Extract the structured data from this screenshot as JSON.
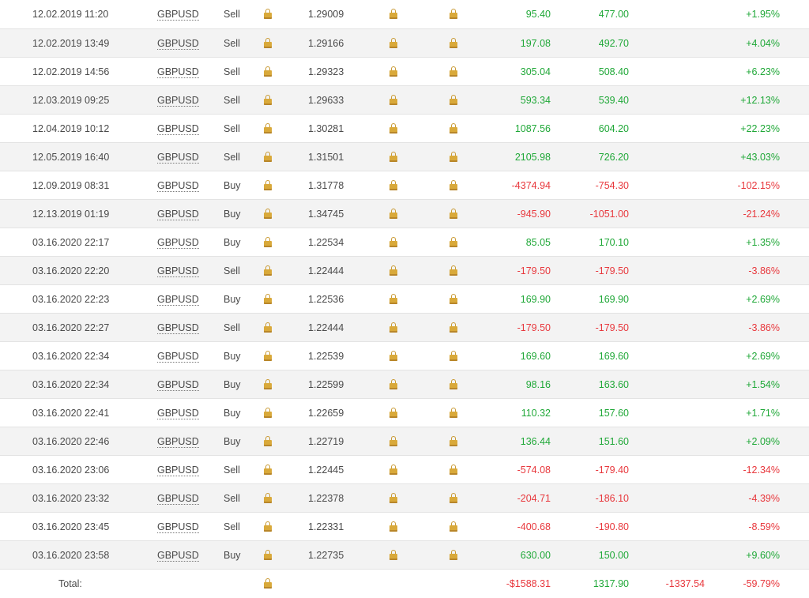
{
  "table": {
    "rows": [
      {
        "date": "12.02.2019 11:20",
        "symbol": "GBPUSD",
        "type": "Sell",
        "price": "1.29009",
        "profit": "95.40",
        "pips": "477.00",
        "gain": "+1.95%",
        "sign": "pos"
      },
      {
        "date": "12.02.2019 13:49",
        "symbol": "GBPUSD",
        "type": "Sell",
        "price": "1.29166",
        "profit": "197.08",
        "pips": "492.70",
        "gain": "+4.04%",
        "sign": "pos"
      },
      {
        "date": "12.02.2019 14:56",
        "symbol": "GBPUSD",
        "type": "Sell",
        "price": "1.29323",
        "profit": "305.04",
        "pips": "508.40",
        "gain": "+6.23%",
        "sign": "pos"
      },
      {
        "date": "12.03.2019 09:25",
        "symbol": "GBPUSD",
        "type": "Sell",
        "price": "1.29633",
        "profit": "593.34",
        "pips": "539.40",
        "gain": "+12.13%",
        "sign": "pos"
      },
      {
        "date": "12.04.2019 10:12",
        "symbol": "GBPUSD",
        "type": "Sell",
        "price": "1.30281",
        "profit": "1087.56",
        "pips": "604.20",
        "gain": "+22.23%",
        "sign": "pos"
      },
      {
        "date": "12.05.2019 16:40",
        "symbol": "GBPUSD",
        "type": "Sell",
        "price": "1.31501",
        "profit": "2105.98",
        "pips": "726.20",
        "gain": "+43.03%",
        "sign": "pos"
      },
      {
        "date": "12.09.2019 08:31",
        "symbol": "GBPUSD",
        "type": "Buy",
        "price": "1.31778",
        "profit": "-4374.94",
        "pips": "-754.30",
        "gain": "-102.15%",
        "sign": "neg"
      },
      {
        "date": "12.13.2019 01:19",
        "symbol": "GBPUSD",
        "type": "Buy",
        "price": "1.34745",
        "profit": "-945.90",
        "pips": "-1051.00",
        "gain": "-21.24%",
        "sign": "neg"
      },
      {
        "date": "03.16.2020 22:17",
        "symbol": "GBPUSD",
        "type": "Buy",
        "price": "1.22534",
        "profit": "85.05",
        "pips": "170.10",
        "gain": "+1.35%",
        "sign": "pos"
      },
      {
        "date": "03.16.2020 22:20",
        "symbol": "GBPUSD",
        "type": "Sell",
        "price": "1.22444",
        "profit": "-179.50",
        "pips": "-179.50",
        "gain": "-3.86%",
        "sign": "neg"
      },
      {
        "date": "03.16.2020 22:23",
        "symbol": "GBPUSD",
        "type": "Buy",
        "price": "1.22536",
        "profit": "169.90",
        "pips": "169.90",
        "gain": "+2.69%",
        "sign": "pos"
      },
      {
        "date": "03.16.2020 22:27",
        "symbol": "GBPUSD",
        "type": "Sell",
        "price": "1.22444",
        "profit": "-179.50",
        "pips": "-179.50",
        "gain": "-3.86%",
        "sign": "neg"
      },
      {
        "date": "03.16.2020 22:34",
        "symbol": "GBPUSD",
        "type": "Buy",
        "price": "1.22539",
        "profit": "169.60",
        "pips": "169.60",
        "gain": "+2.69%",
        "sign": "pos"
      },
      {
        "date": "03.16.2020 22:34",
        "symbol": "GBPUSD",
        "type": "Buy",
        "price": "1.22599",
        "profit": "98.16",
        "pips": "163.60",
        "gain": "+1.54%",
        "sign": "pos"
      },
      {
        "date": "03.16.2020 22:41",
        "symbol": "GBPUSD",
        "type": "Buy",
        "price": "1.22659",
        "profit": "110.32",
        "pips": "157.60",
        "gain": "+1.71%",
        "sign": "pos"
      },
      {
        "date": "03.16.2020 22:46",
        "symbol": "GBPUSD",
        "type": "Buy",
        "price": "1.22719",
        "profit": "136.44",
        "pips": "151.60",
        "gain": "+2.09%",
        "sign": "pos"
      },
      {
        "date": "03.16.2020 23:06",
        "symbol": "GBPUSD",
        "type": "Sell",
        "price": "1.22445",
        "profit": "-574.08",
        "pips": "-179.40",
        "gain": "-12.34%",
        "sign": "neg"
      },
      {
        "date": "03.16.2020 23:32",
        "symbol": "GBPUSD",
        "type": "Sell",
        "price": "1.22378",
        "profit": "-204.71",
        "pips": "-186.10",
        "gain": "-4.39%",
        "sign": "neg"
      },
      {
        "date": "03.16.2020 23:45",
        "symbol": "GBPUSD",
        "type": "Sell",
        "price": "1.22331",
        "profit": "-400.68",
        "pips": "-190.80",
        "gain": "-8.59%",
        "sign": "neg"
      },
      {
        "date": "03.16.2020 23:58",
        "symbol": "GBPUSD",
        "type": "Buy",
        "price": "1.22735",
        "profit": "630.00",
        "pips": "150.00",
        "gain": "+9.60%",
        "sign": "pos"
      }
    ],
    "total": {
      "label": "Total:",
      "profit": "-$1588.31",
      "pips": "1317.90",
      "extra": "-1337.54",
      "gain": "-59.79%"
    }
  },
  "icons": {
    "locked": "lock-icon"
  },
  "colors": {
    "positive": "#20a838",
    "negative": "#e8383d",
    "alt_row": "#f3f3f3"
  }
}
